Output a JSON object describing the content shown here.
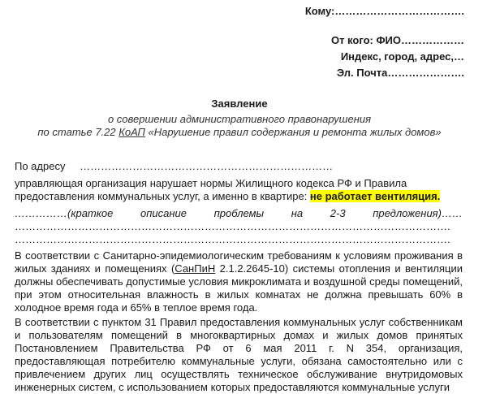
{
  "header": {
    "to_line": "Кому:……………………………….",
    "from_line": "От кого: ФИО………………",
    "address_line": "Индекс, город, адрес,…",
    "email_line": "Эл. Почта…………………."
  },
  "title": "Заявление",
  "subtitle": {
    "line1": "о совершении административного правонарушения",
    "line2_pre": "по статье 7.22 ",
    "line2_link": "КоАП",
    "line2_post": " «Нарушение правил содержания и ремонта жилых домов»"
  },
  "address": {
    "label": "По адресу",
    "dots": "………………………………………………………………"
  },
  "violation": {
    "line1": "управляющая организация  нарушает нормы Жилищного кодекса РФ и Правила",
    "line2_pre": "предоставления коммунальных услуг, а именно в квартире: ",
    "line2_highlight": "не работает вентиляция."
  },
  "description": {
    "words": [
      "……………(краткое",
      "описание",
      "проблемы",
      "на",
      "2-3",
      "предложения)……"
    ],
    "dots1": "…………………………………………………………………………………………………………….",
    "dots2": "……………………………………………………………………………………………………………."
  },
  "para1": {
    "pre": "В соответствии с Санитарно-эпидемиологическим требованиям к условиям проживания в жилых зданиях и помещениях (",
    "link": "СанПиН",
    "post": " 2.1.2.2645-10) системы отопления и вентиляции должны обеспечивать допустимые условия микроклимата и воздушной среды помещений, при этом относительная влажность в жилых комнатах не должна превышать 60% в холодное время года и 65% в теплое время года."
  },
  "para2": "В соответствии с пунктом 31 Правил предоставления коммунальных услуг собственникам и пользователям помещений в многоквартирных домах и жилых домов принятых Постановлением Правительства РФ от 6 мая 2011 г. N 354, организация, предоставляющая потребителю коммунальные услуги, обязана самостоятельно или с привлечением других лиц осуществлять техническое обслуживание внутридомовых инженерных систем, с использованием которых предоставляются коммунальные услуги"
}
